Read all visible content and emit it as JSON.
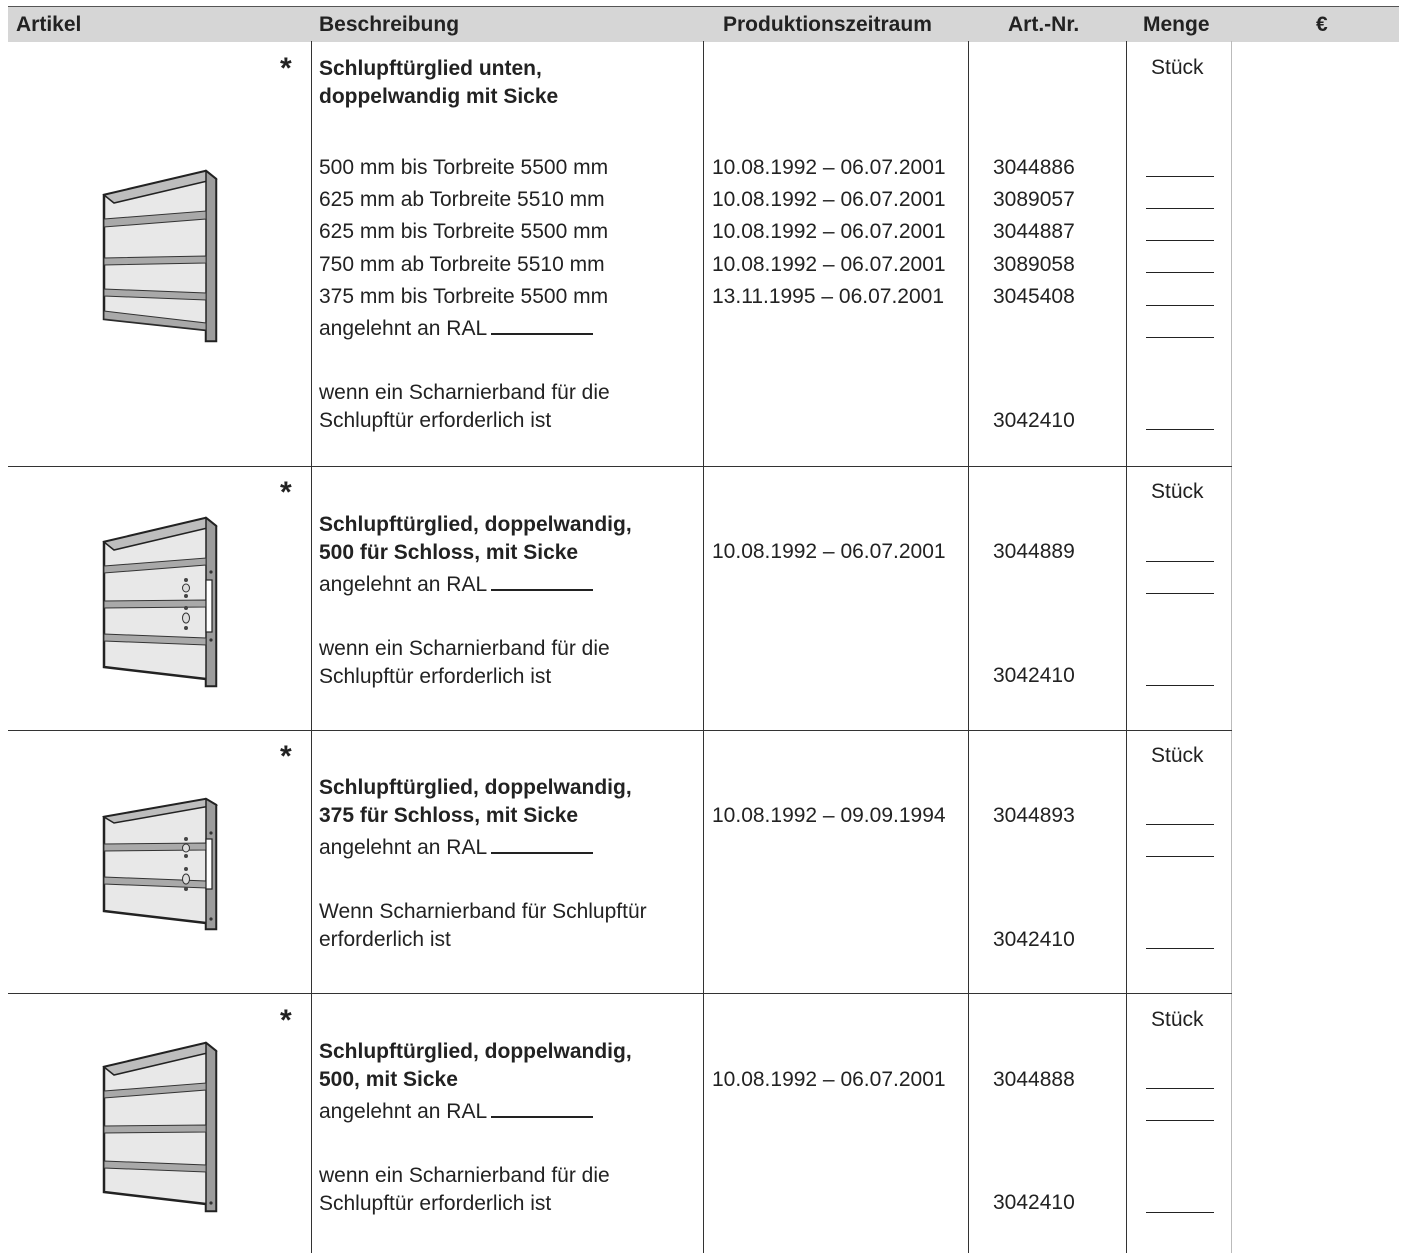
{
  "header": {
    "col_artikel": "Artikel",
    "col_beschreibung": "Beschreibung",
    "col_produktionszeitraum": "Produktionszeitraum",
    "col_artnr": "Art.-Nr.",
    "col_menge": "Menge",
    "col_euro": "€"
  },
  "rows": [
    {
      "star": "*",
      "title_line1": "Schlupftürglied unten,",
      "title_line2": "doppelwandig mit Sicke",
      "unit": "Stück",
      "variants": [
        {
          "desc": "500 mm bis Torbreite 5500 mm",
          "period": "10.08.1992 – 06.07.2001",
          "artnr": "3044886"
        },
        {
          "desc": "625 mm ab Torbreite 5510 mm",
          "period": "10.08.1992 – 06.07.2001",
          "artnr": "3089057"
        },
        {
          "desc": "625 mm bis Torbreite 5500 mm",
          "period": "10.08.1992 – 06.07.2001",
          "artnr": "3044887"
        },
        {
          "desc": "750 mm ab Torbreite 5510 mm",
          "period": "10.08.1992 – 06.07.2001",
          "artnr": "3089058"
        },
        {
          "desc": "375 mm bis Torbreite 5500 mm",
          "period": "13.11.1995 – 06.07.2001",
          "artnr": "3045408"
        }
      ],
      "ral": "angelehnt an RAL",
      "hinge_line1": "wenn ein Scharnierband für die",
      "hinge_line2": "Schlupftür erforderlich ist",
      "hinge_artnr": "3042410"
    },
    {
      "star": "*",
      "title_line1": "Schlupftürglied, doppelwandig,",
      "title_line2": "500 für Schloss, mit Sicke",
      "unit": "Stück",
      "period": "10.08.1992 – 06.07.2001",
      "artnr": "3044889",
      "ral": "angelehnt an RAL",
      "hinge_line1": "wenn ein Scharnierband für die",
      "hinge_line2": "Schlupftür erforderlich ist",
      "hinge_artnr": "3042410"
    },
    {
      "star": "*",
      "title_line1": "Schlupftürglied, doppelwandig,",
      "title_line2": "375 für Schloss, mit Sicke",
      "unit": "Stück",
      "period": "10.08.1992 – 09.09.1994",
      "artnr": "3044893",
      "ral": "angelehnt an RAL",
      "hinge_line1": "Wenn Scharnierband für Schlupftür",
      "hinge_line2": "erforderlich ist",
      "hinge_artnr": "3042410"
    },
    {
      "star": "*",
      "title_line1": "Schlupftürglied, doppelwandig,",
      "title_line2": "500, mit Sicke",
      "unit": "Stück",
      "period": "10.08.1992 – 06.07.2001",
      "artnr": "3044888",
      "ral": "angelehnt an RAL",
      "hinge_line1": "wenn ein Scharnierband für die",
      "hinge_line2": "Schlupftür erforderlich ist",
      "hinge_artnr": "3042410"
    }
  ]
}
